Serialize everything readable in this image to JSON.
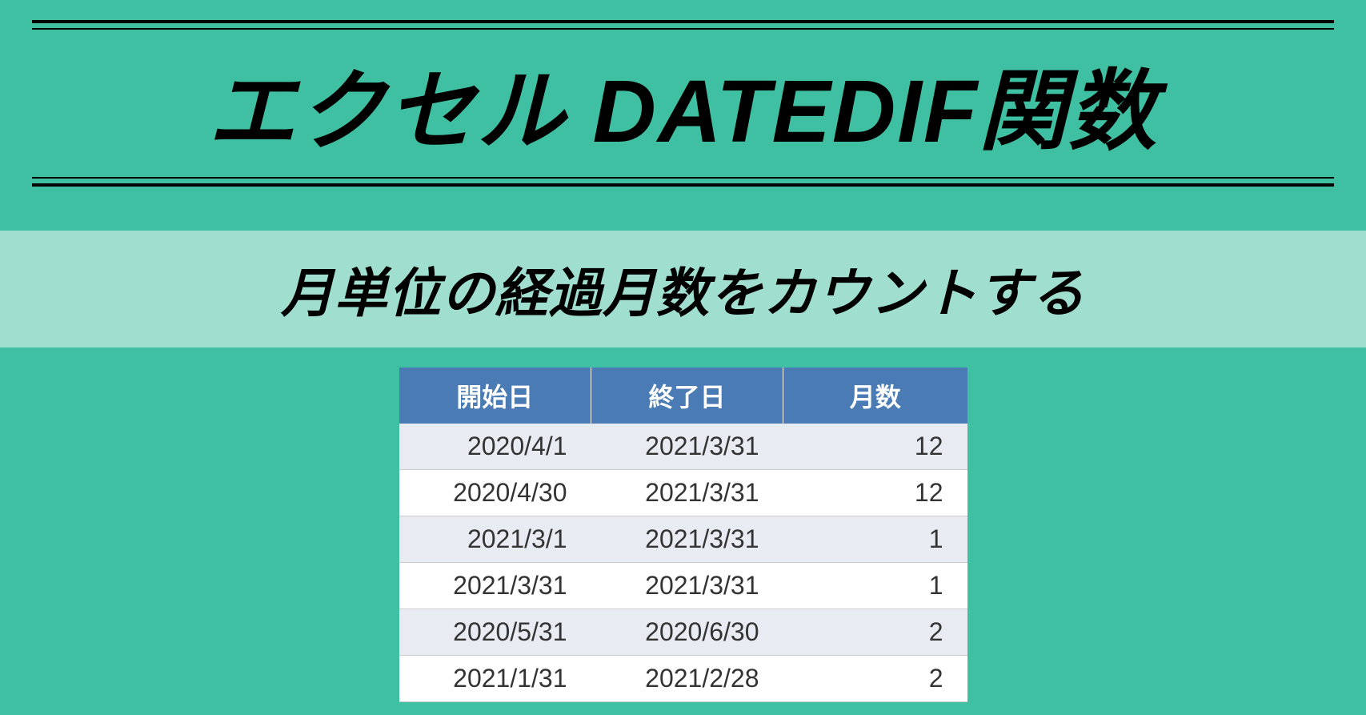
{
  "title": "エクセル DATEDIF関数",
  "subtitle": "月単位の経過月数をカウントする",
  "table": {
    "headers": {
      "start": "開始日",
      "end": "終了日",
      "months": "月数"
    },
    "rows": [
      {
        "start": "2020/4/1",
        "end": "2021/3/31",
        "months": "12"
      },
      {
        "start": "2020/4/30",
        "end": "2021/3/31",
        "months": "12"
      },
      {
        "start": "2021/3/1",
        "end": "2021/3/31",
        "months": "1"
      },
      {
        "start": "2021/3/31",
        "end": "2021/3/31",
        "months": "1"
      },
      {
        "start": "2020/5/31",
        "end": "2020/6/30",
        "months": "2"
      },
      {
        "start": "2021/1/31",
        "end": "2021/2/28",
        "months": "2"
      }
    ]
  }
}
